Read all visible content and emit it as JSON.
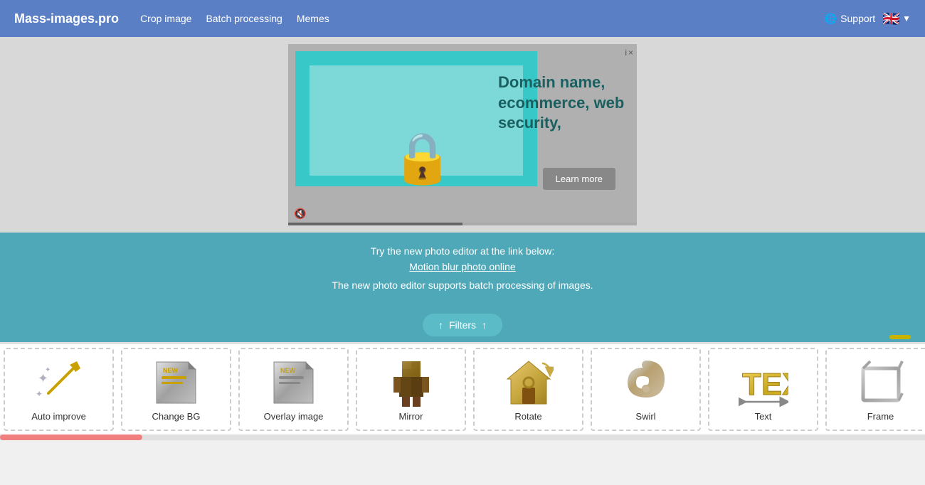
{
  "header": {
    "logo": "Mass-images.pro",
    "nav": [
      {
        "label": "Crop image",
        "id": "crop-image"
      },
      {
        "label": "Batch processing",
        "id": "batch-processing"
      },
      {
        "label": "Memes",
        "id": "memes"
      }
    ],
    "support_label": "Support",
    "flag_emoji": "🇬🇧",
    "caret": "▼"
  },
  "ad": {
    "headline": "Domain name, ecommerce, web security,",
    "learn_more": "Learn more",
    "info_label": "i",
    "close_label": "×"
  },
  "info_banner": {
    "line1": "Try the new photo editor at the link below:",
    "link_text": "Motion blur photo online",
    "line2": "The new photo editor supports batch processing of images."
  },
  "filters_button": {
    "label": "Filters",
    "arrow_up1": "↑",
    "arrow_up2": "↑"
  },
  "tools": [
    {
      "id": "auto-improve",
      "label": "Auto improve",
      "icon": "✨",
      "new": false
    },
    {
      "id": "change-bg",
      "label": "Change BG",
      "icon": "📄",
      "new": true
    },
    {
      "id": "overlay-image",
      "label": "Overlay image",
      "icon": "📄",
      "new": true
    },
    {
      "id": "mirror",
      "label": "Mirror",
      "icon": "🪞",
      "new": false
    },
    {
      "id": "rotate",
      "label": "Rotate",
      "icon": "🏠",
      "new": false
    },
    {
      "id": "swirl",
      "label": "Swirl",
      "icon": "🌀",
      "new": false
    },
    {
      "id": "text",
      "label": "Text",
      "icon": "T",
      "new": false
    },
    {
      "id": "frame",
      "label": "Frame",
      "icon": "🖼",
      "new": false
    }
  ]
}
